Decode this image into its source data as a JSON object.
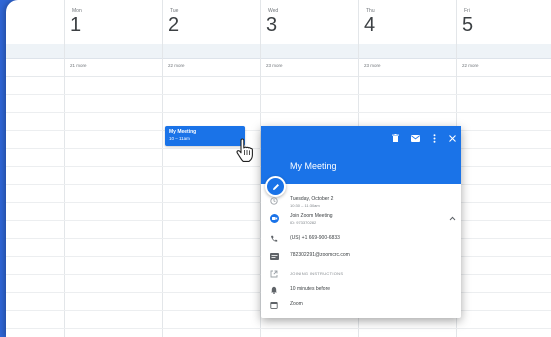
{
  "calendar": {
    "days": [
      {
        "dow": "Mon",
        "num": "1",
        "more": "21 more"
      },
      {
        "dow": "Tue",
        "num": "2",
        "more": "22 more"
      },
      {
        "dow": "Wed",
        "num": "3",
        "more": "23 more"
      },
      {
        "dow": "Thu",
        "num": "4",
        "more": "23 more"
      },
      {
        "dow": "Fri",
        "num": "5",
        "more": "22 more"
      }
    ]
  },
  "event": {
    "title": "My Meeting",
    "time": "10 – 11am"
  },
  "popup": {
    "title": "My Meeting",
    "date": "Tuesday, October 2",
    "time_range": "10:30 – 11:30am",
    "join_label": "Join Zoom Meeting",
    "meeting_id": "ID: 973370282",
    "phone": "(US) +1 669-900-6833",
    "email": "782302291@zoomcrc.com",
    "instructions": "JOINING INSTRUCTIONS",
    "reminder": "10 minutes before",
    "calendar": "Zoom"
  },
  "colors": {
    "accent": "#1a73e8",
    "background": "#2f66d6"
  }
}
